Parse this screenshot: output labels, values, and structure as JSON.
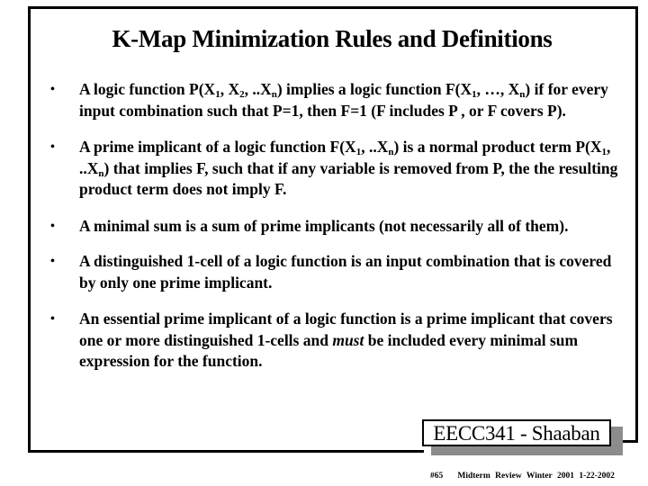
{
  "slide": {
    "title": "K-Map Minimization Rules and Definitions",
    "bullet_glyph": "•",
    "bullets": [
      {
        "parts": {
          "a": "A logic function P(X",
          "s1": "1",
          "b": ", X",
          "s2": "2",
          "c": ", ..X",
          "s3": "n",
          "d": ") implies a logic function F(X",
          "s4": "1",
          "e": ", …, X",
          "s5": "n",
          "f": ") if for every input combination such that P=1, then F=1    (F includes P   , or  F covers P)."
        }
      },
      {
        "parts": {
          "a": "A prime implicant of a logic function F(X",
          "s1": "1",
          "b": ", ..X",
          "s2": "n",
          "c": ")  is a normal product term P(X",
          "s3": "1",
          "d": ", ..X",
          "s4": "n",
          "e": ") that implies F, such that if any variable is removed from P, the the resulting product term does not imply F."
        }
      },
      {
        "text": "A minimal sum is a sum of prime implicants (not necessarily all of them)."
      },
      {
        "text": "A distinguished 1-cell of a logic function is an input combination that is covered by only one prime implicant."
      },
      {
        "parts": {
          "a": "An essential prime implicant of a logic function is a prime implicant that covers one or more distinguished 1-cells and ",
          "em": "must",
          "b": " be included every minimal sum expression for the function."
        }
      }
    ]
  },
  "footer": {
    "label": "EECC341 - Shaaban",
    "slide_number": "#65",
    "subtitle": "Midterm Review  Winter 2001  1-22-2002"
  }
}
